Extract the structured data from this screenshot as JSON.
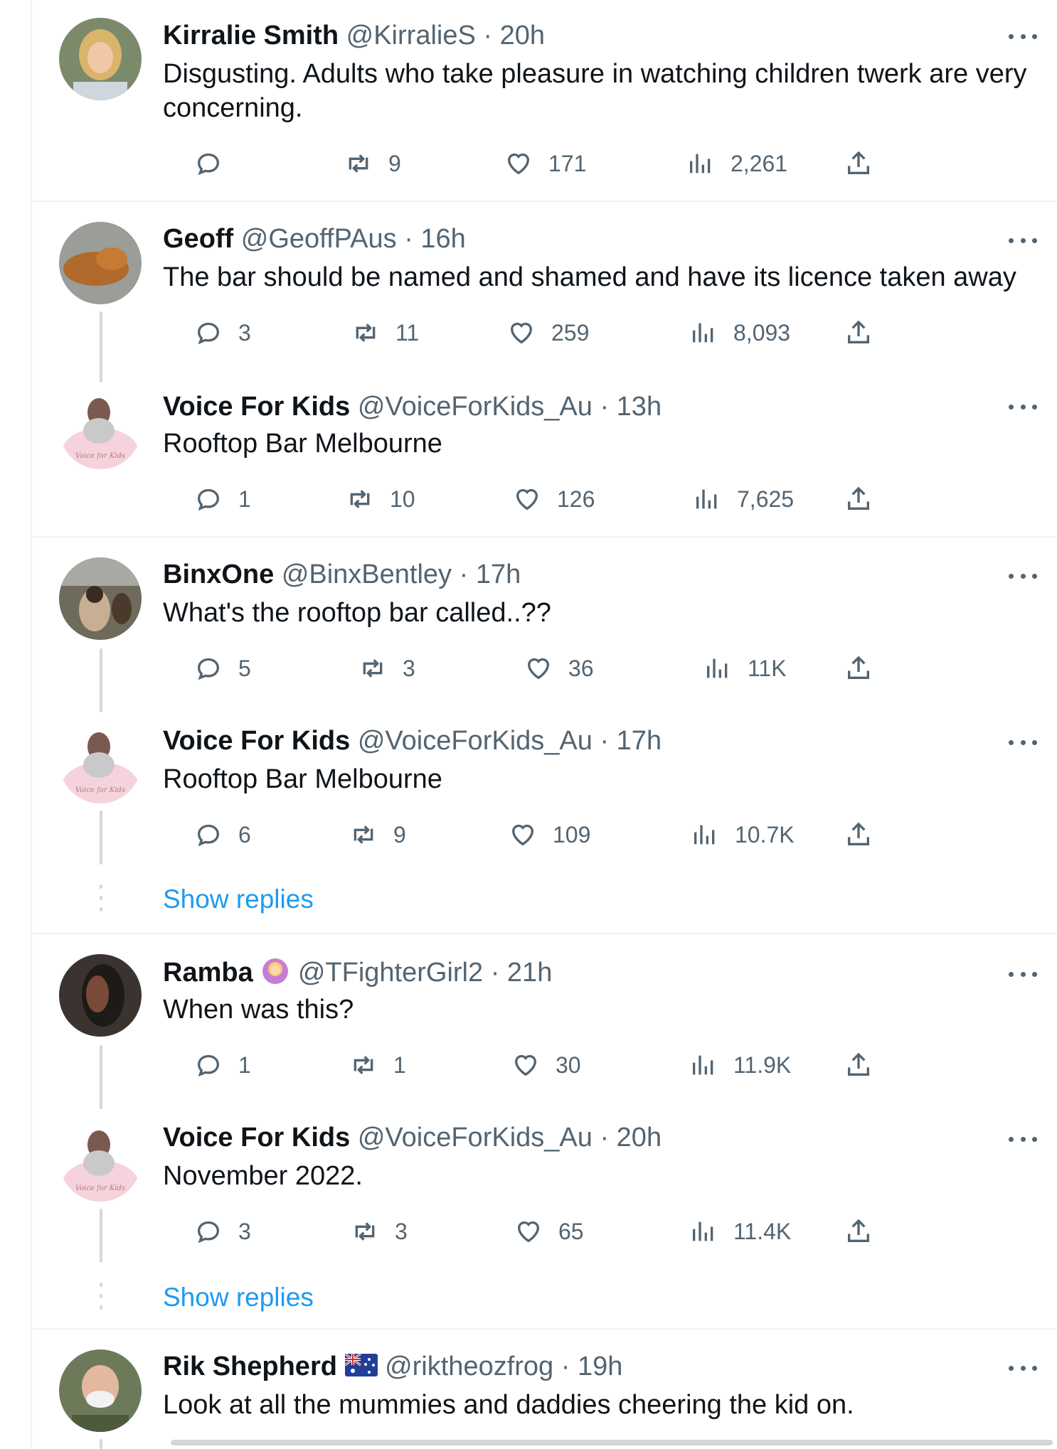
{
  "tweets": [
    {
      "name": "Kirralie Smith",
      "handle": "@KirralieS",
      "time": "20h",
      "text": "Disgusting. Adults who take pleasure in watching children twerk are very concerning.",
      "replies": "",
      "retweets": "9",
      "likes": "171",
      "views": "2,261"
    },
    {
      "name": "Geoff",
      "handle": "@GeoffPAus",
      "time": "16h",
      "text": "The bar should be named and shamed and have its licence taken away",
      "replies": "3",
      "retweets": "11",
      "likes": "259",
      "views": "8,093"
    },
    {
      "name": "Voice For Kids",
      "handle": "@VoiceForKids_Au",
      "time": "13h",
      "text": "Rooftop Bar Melbourne",
      "replies": "1",
      "retweets": "10",
      "likes": "126",
      "views": "7,625"
    },
    {
      "name": "BinxOne",
      "handle": "@BinxBentley",
      "time": "17h",
      "text": "What's the rooftop bar called..??",
      "replies": "5",
      "retweets": "3",
      "likes": "36",
      "views": "11K"
    },
    {
      "name": "Voice For Kids",
      "handle": "@VoiceForKids_Au",
      "time": "17h",
      "text": "Rooftop Bar Melbourne",
      "replies": "6",
      "retweets": "9",
      "likes": "109",
      "views": "10.7K"
    },
    {
      "name": "Ramba",
      "handle": "@TFighterGirl2",
      "time": "21h",
      "text": "When was this?",
      "replies": "1",
      "retweets": "1",
      "likes": "30",
      "views": "11.9K"
    },
    {
      "name": "Voice For Kids",
      "handle": "@VoiceForKids_Au",
      "time": "20h",
      "text": "November 2022.",
      "replies": "3",
      "retweets": "3",
      "likes": "65",
      "views": "11.4K"
    },
    {
      "name": "Rik Shepherd",
      "handle": "@riktheozfrog",
      "time": "19h",
      "text": "Look at all the mummies and daddies cheering the kid on."
    }
  ],
  "show_replies_label": "Show replies",
  "separator": "·",
  "voice_avatar_text": "Voice for Kids",
  "colors": {
    "link": "#1d9bf0",
    "muted": "#536471",
    "text": "#0f1419",
    "divider": "#eff3f4"
  }
}
